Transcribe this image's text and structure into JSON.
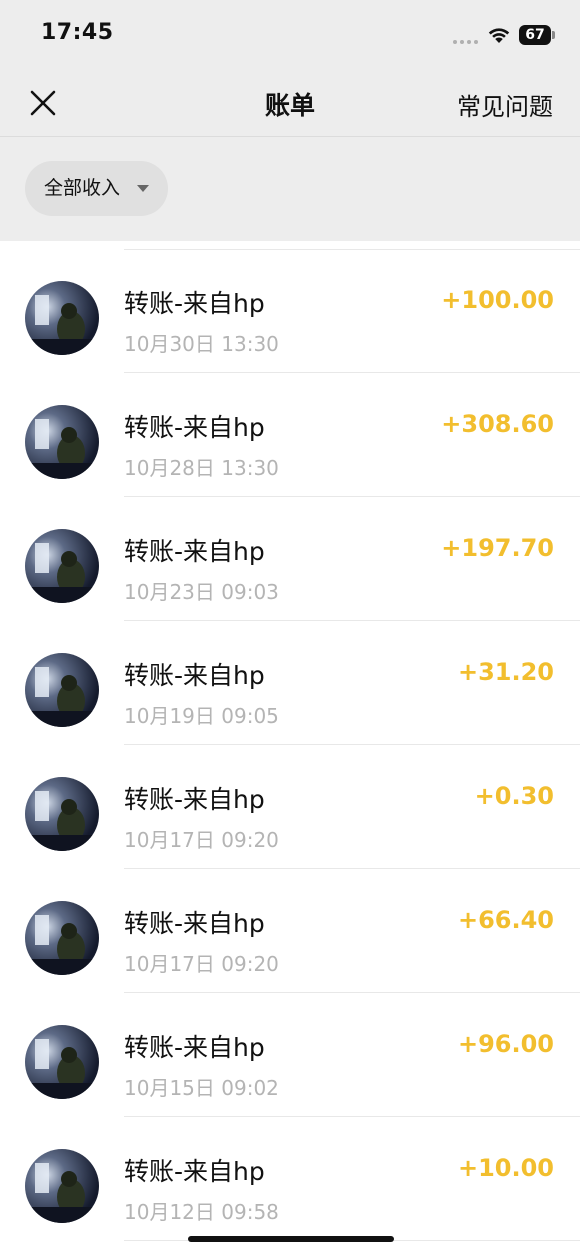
{
  "status_bar": {
    "time": "17:45",
    "battery": "67"
  },
  "nav": {
    "title": "账单",
    "faq": "常见问题"
  },
  "filter": {
    "label": "全部收入"
  },
  "colors": {
    "background": "#ededed",
    "amount": "#f2be2e",
    "secondary_text": "#b4b4b4"
  },
  "icons": [
    "close-icon",
    "wifi-icon",
    "battery-icon",
    "caret-down-icon"
  ],
  "transactions": [
    {
      "title": "转账-来自hp",
      "time": "10月30日 13:30",
      "amount": "+100.00"
    },
    {
      "title": "转账-来自hp",
      "time": "10月28日 13:30",
      "amount": "+308.60"
    },
    {
      "title": "转账-来自hp",
      "time": "10月23日 09:03",
      "amount": "+197.70"
    },
    {
      "title": "转账-来自hp",
      "time": "10月19日 09:05",
      "amount": "+31.20"
    },
    {
      "title": "转账-来自hp",
      "time": "10月17日 09:20",
      "amount": "+0.30"
    },
    {
      "title": "转账-来自hp",
      "time": "10月17日 09:20",
      "amount": "+66.40"
    },
    {
      "title": "转账-来自hp",
      "time": "10月15日 09:02",
      "amount": "+96.00"
    },
    {
      "title": "转账-来自hp",
      "time": "10月12日 09:58",
      "amount": "+10.00"
    }
  ]
}
